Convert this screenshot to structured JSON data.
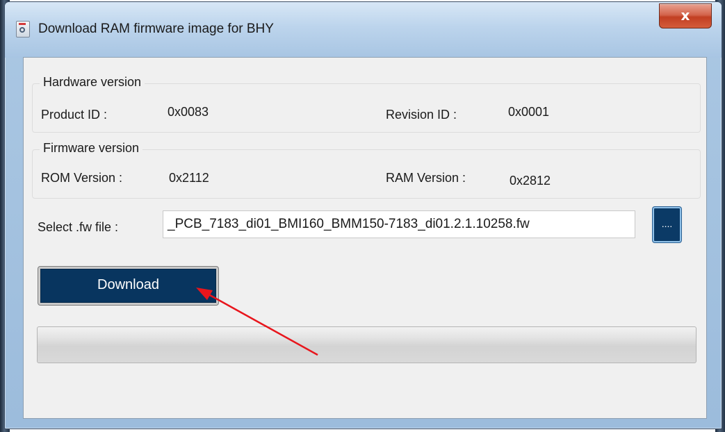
{
  "window": {
    "title": "Download RAM firmware image for BHY",
    "close_label": "x"
  },
  "hardware": {
    "legend": "Hardware version",
    "product_id_label": "Product ID :",
    "product_id_value": "0x0083",
    "revision_id_label": "Revision ID :",
    "revision_id_value": "0x0001"
  },
  "firmware": {
    "legend": "Firmware version",
    "rom_label": "ROM Version :",
    "rom_value": "0x2112",
    "ram_label": "RAM Version :",
    "ram_value": "0x2812"
  },
  "file": {
    "label": "Select .fw file :",
    "value": "_PCB_7183_di01_BMI160_BMM150-7183_di01.2.1.10258.fw",
    "browse_label": "...."
  },
  "actions": {
    "download_label": "Download"
  },
  "progress": {
    "fraction": 0
  },
  "annotation": {
    "arrow_color": "#e8151c"
  },
  "icons": [
    "app-icon",
    "close-icon",
    "arrow-annotation"
  ]
}
